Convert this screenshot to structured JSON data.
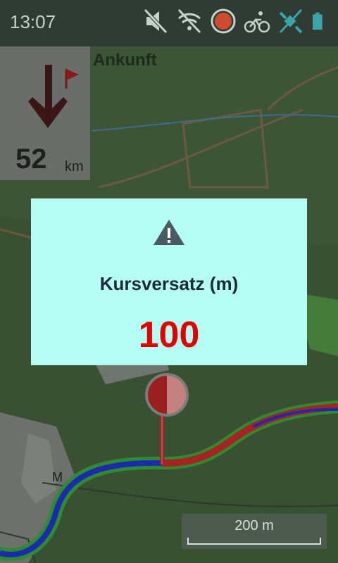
{
  "status_bar": {
    "time": "13:07",
    "icons": [
      "mute-icon",
      "no-wifi-icon",
      "record-icon",
      "cycling-icon",
      "gps-icon",
      "battery-icon"
    ]
  },
  "navigation": {
    "distance_value": "52",
    "distance_unit": "km",
    "destination_label": "Ankunft"
  },
  "dialog": {
    "icon": "warning-icon",
    "title": "Kursversatz (m)",
    "value": "100"
  },
  "map": {
    "place_label": "M",
    "scale_label": "200 m"
  },
  "colors": {
    "dialog_bg": "#b6fff5",
    "value_red": "#e00000",
    "route_red": "#a52323",
    "route_blue": "#1a2bb0",
    "route_green": "#2e8b2e"
  }
}
